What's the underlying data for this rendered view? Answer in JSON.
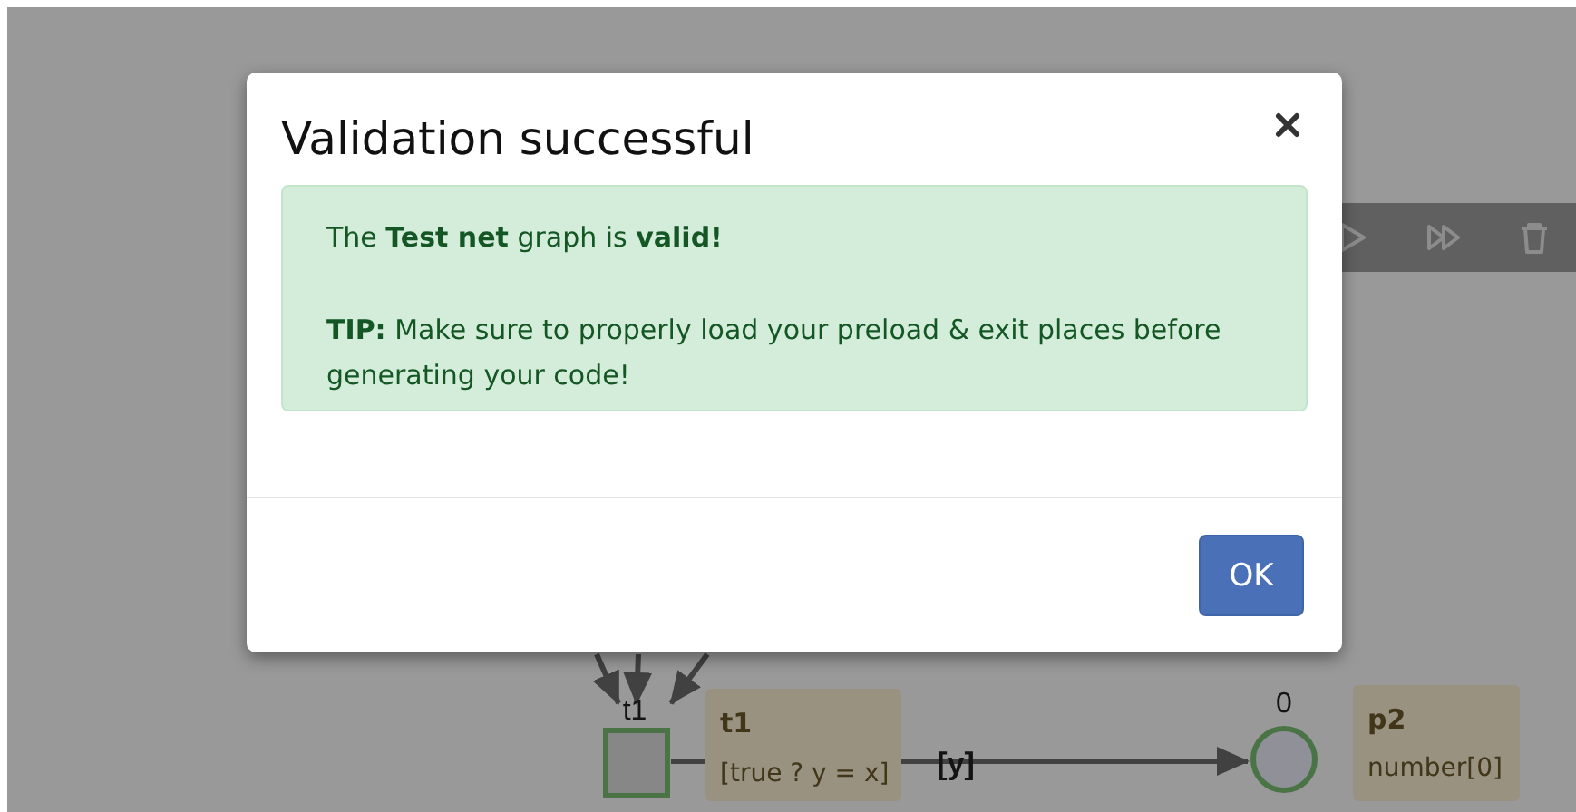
{
  "toolbar": {
    "buttons": [
      {
        "kind": "play"
      },
      {
        "kind": "fast-forward"
      },
      {
        "kind": "delete"
      }
    ]
  },
  "canvas": {
    "transitions": [
      {
        "name": "t1",
        "label": "t1",
        "guard": "[true ? y = x]"
      }
    ],
    "places": [
      {
        "name": "p2",
        "tokens": "0",
        "type": "number[0]"
      }
    ],
    "arcs": [
      {
        "label": "[y]"
      }
    ]
  },
  "modal": {
    "title": "Validation successful",
    "message": "The **Test net** graph is **valid!**",
    "tip": "**TIP:** Make sure to properly load your preload & exit places before generating your code!",
    "buttons": [
      {
        "label": "OK",
        "kind": "primary"
      }
    ]
  }
}
